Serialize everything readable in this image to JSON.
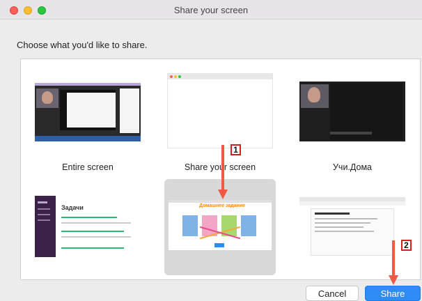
{
  "window": {
    "title": "Share your screen"
  },
  "prompt": "Choose what you'd like to share.",
  "tiles": [
    {
      "label": "Entire screen"
    },
    {
      "label": "Share your screen"
    },
    {
      "label": "Учи.Дома"
    },
    {
      "label": ""
    },
    {
      "label": ""
    },
    {
      "label": ""
    }
  ],
  "thumbs": {
    "t4_heading": "Задачи",
    "t5_heading": "Домашнее задание"
  },
  "buttons": {
    "cancel": "Cancel",
    "share": "Share"
  },
  "annotations": {
    "one": "1",
    "two": "2"
  },
  "colors": {
    "accent": "#2f8cf6",
    "annotation_arrow": "#f05a44",
    "annotation_box": "#d32020"
  }
}
